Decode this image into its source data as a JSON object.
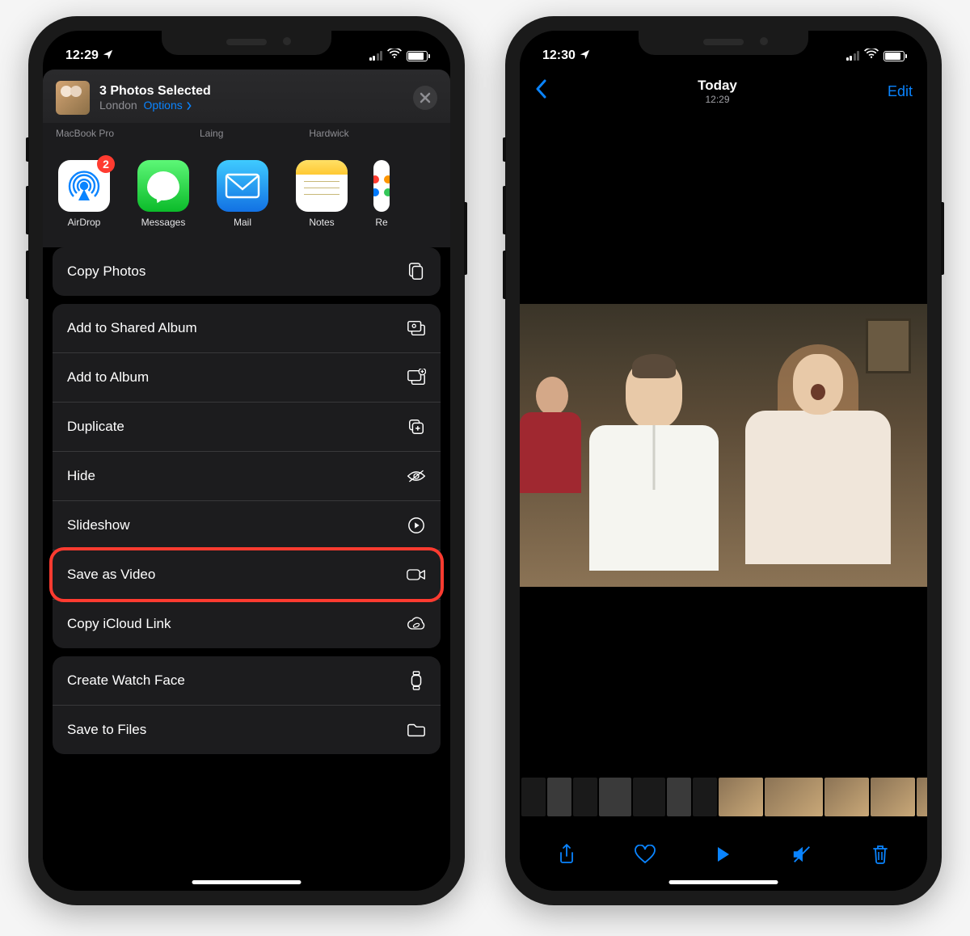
{
  "left": {
    "status_time": "12:29",
    "share": {
      "title": "3 Photos Selected",
      "location": "London",
      "options_label": "Options",
      "airdrop_targets": [
        "MacBook Pro",
        "Laing",
        "Hardwick"
      ],
      "apps": [
        {
          "label": "AirDrop",
          "badge": "2"
        },
        {
          "label": "Messages"
        },
        {
          "label": "Mail"
        },
        {
          "label": "Notes"
        },
        {
          "label": "Re"
        }
      ],
      "group1": [
        {
          "label": "Copy Photos",
          "icon": "copy"
        }
      ],
      "group2": [
        {
          "label": "Add to Shared Album",
          "icon": "shared-album"
        },
        {
          "label": "Add to Album",
          "icon": "add-album"
        },
        {
          "label": "Duplicate",
          "icon": "duplicate"
        },
        {
          "label": "Hide",
          "icon": "hide"
        },
        {
          "label": "Slideshow",
          "icon": "play-circle"
        },
        {
          "label": "Save as Video",
          "icon": "video",
          "highlight": true
        },
        {
          "label": "Copy iCloud Link",
          "icon": "cloud-link"
        }
      ],
      "group3": [
        {
          "label": "Create Watch Face",
          "icon": "watch"
        },
        {
          "label": "Save to Files",
          "icon": "folder"
        }
      ]
    }
  },
  "right": {
    "status_time": "12:30",
    "nav": {
      "title": "Today",
      "subtitle": "12:29",
      "edit": "Edit"
    }
  }
}
